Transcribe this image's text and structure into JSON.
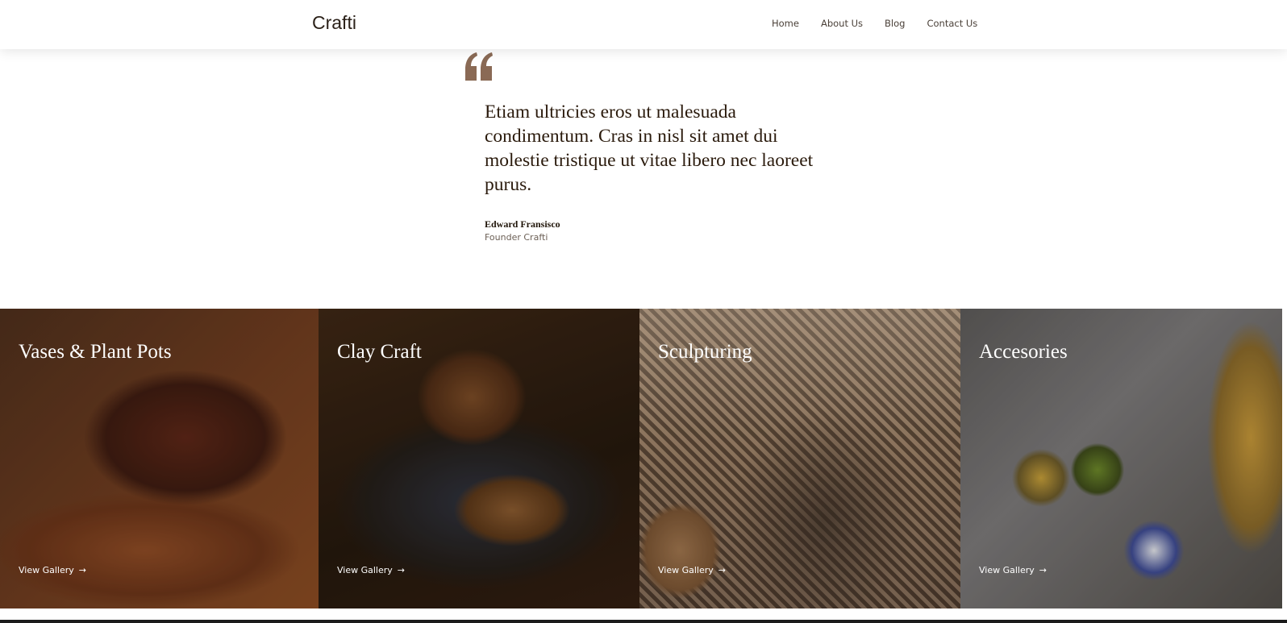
{
  "header": {
    "logo": "Crafti",
    "nav": [
      "Home",
      "About Us",
      "Blog",
      "Contact Us"
    ]
  },
  "testimonial": {
    "quote_icon": "quote-icon",
    "text": "Etiam ultricies eros ut malesuada condimentum. Cras in nisl sit amet dui molestie tristique ut vitae libero nec laoreet purus.",
    "author": "Edward Fransisco",
    "role": "Founder Crafti"
  },
  "gallery": [
    {
      "title": "Vases & Plant Pots",
      "link": "View Gallery"
    },
    {
      "title": "Clay Craft",
      "link": "View Gallery"
    },
    {
      "title": "Sculpturing",
      "link": "View Gallery"
    },
    {
      "title": "Accesories",
      "link": "View Gallery"
    }
  ],
  "colors": {
    "quote_mark": "#8a6a55",
    "text_dark": "#2a1a0c"
  }
}
